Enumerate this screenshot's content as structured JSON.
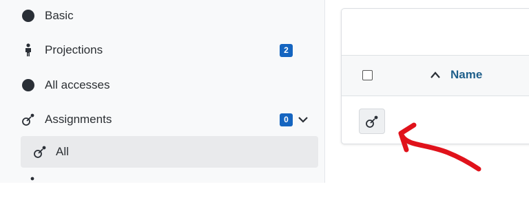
{
  "sidebar": {
    "items": [
      {
        "label": "Basic",
        "icon": "circle-icon"
      },
      {
        "label": "Projections",
        "icon": "person-icon",
        "badge": "2"
      },
      {
        "label": "All accesses",
        "icon": "circle-icon"
      },
      {
        "label": "Assignments",
        "icon": "assign-icon",
        "badge": "0",
        "expanded": true
      }
    ],
    "subitems": [
      {
        "label": "All",
        "icon": "assign-icon",
        "active": true
      }
    ]
  },
  "table": {
    "column_name": "Name",
    "sort": "ascending"
  },
  "colors": {
    "badge": "#1565c0",
    "column_header": "#1f5f8b",
    "annotation": "#e0121b"
  }
}
